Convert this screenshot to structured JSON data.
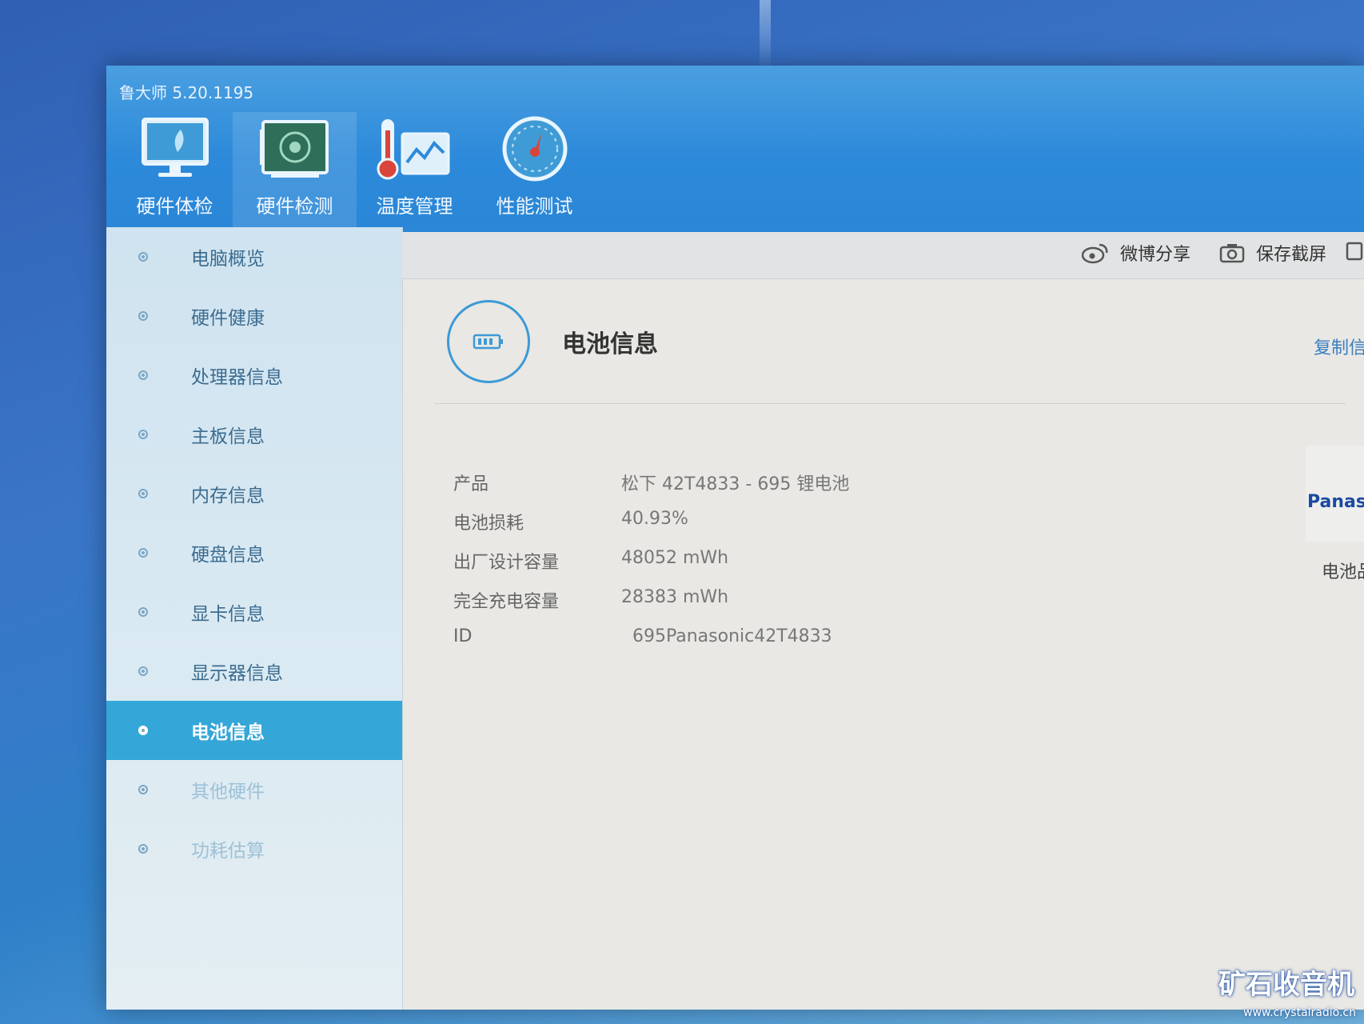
{
  "app": {
    "title": "鲁大师 5.20.1195"
  },
  "top_tabs": [
    {
      "label": "硬件体检",
      "icon": "monitor-icon"
    },
    {
      "label": "硬件检测",
      "icon": "circuit-board-icon"
    },
    {
      "label": "温度管理",
      "icon": "thermometer-chart-icon"
    },
    {
      "label": "性能测试",
      "icon": "speedometer-icon"
    }
  ],
  "sidebar": {
    "items": [
      {
        "label": "电脑概览"
      },
      {
        "label": "硬件健康"
      },
      {
        "label": "处理器信息"
      },
      {
        "label": "主板信息"
      },
      {
        "label": "内存信息"
      },
      {
        "label": "硬盘信息"
      },
      {
        "label": "显卡信息"
      },
      {
        "label": "显示器信息"
      },
      {
        "label": "电池信息",
        "active": true
      },
      {
        "label": "其他硬件"
      },
      {
        "label": "功耗估算"
      }
    ]
  },
  "toolbar": {
    "weibo_share": "微博分享",
    "save_screenshot": "保存截屏"
  },
  "section": {
    "title": "电池信息",
    "copy_link": "复制信"
  },
  "battery_info": [
    {
      "key": "产品",
      "value": "松下 42T4833 -   695 锂电池"
    },
    {
      "key": "电池损耗",
      "value": "40.93%"
    },
    {
      "key": "出厂设计容量",
      "value": "48052 mWh"
    },
    {
      "key": "完全充电容量",
      "value": "28383 mWh"
    },
    {
      "key": "ID",
      "value": "  695Panasonic42T4833"
    }
  ],
  "brand": {
    "logo_text": "Panasonic",
    "caption": "电池品"
  },
  "watermark": {
    "text": "矿石收音机",
    "url": "www.crystalradio.cn"
  },
  "colors": {
    "header_blue": "#2d8ada",
    "active_item": "#34a7d8",
    "accent_ring": "#3d9ad6"
  }
}
